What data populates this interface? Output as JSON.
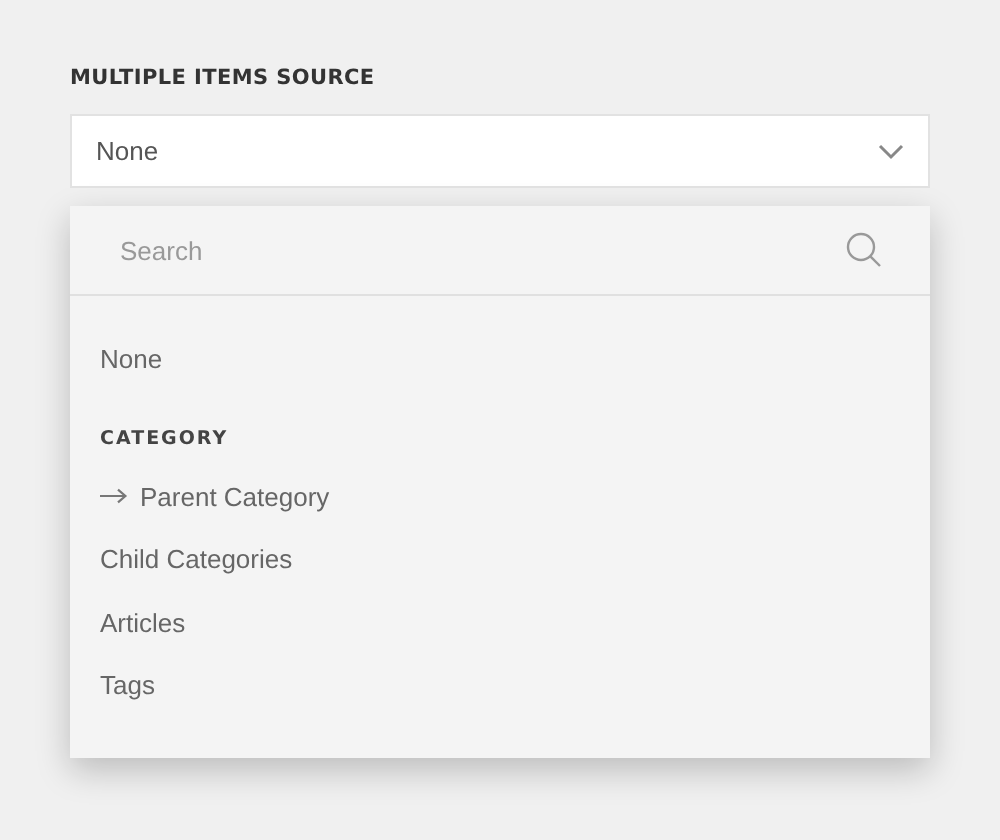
{
  "field": {
    "label": "MULTIPLE ITEMS SOURCE",
    "value": "None"
  },
  "dropdown": {
    "search": {
      "placeholder": "Search"
    },
    "items": [
      {
        "kind": "option",
        "label": "None"
      },
      {
        "kind": "heading",
        "label": "CATEGORY"
      },
      {
        "kind": "arrow-option",
        "label": "Parent Category"
      },
      {
        "kind": "option",
        "label": "Child Categories"
      },
      {
        "kind": "option",
        "label": "Articles"
      },
      {
        "kind": "option",
        "label": "Tags"
      }
    ]
  }
}
